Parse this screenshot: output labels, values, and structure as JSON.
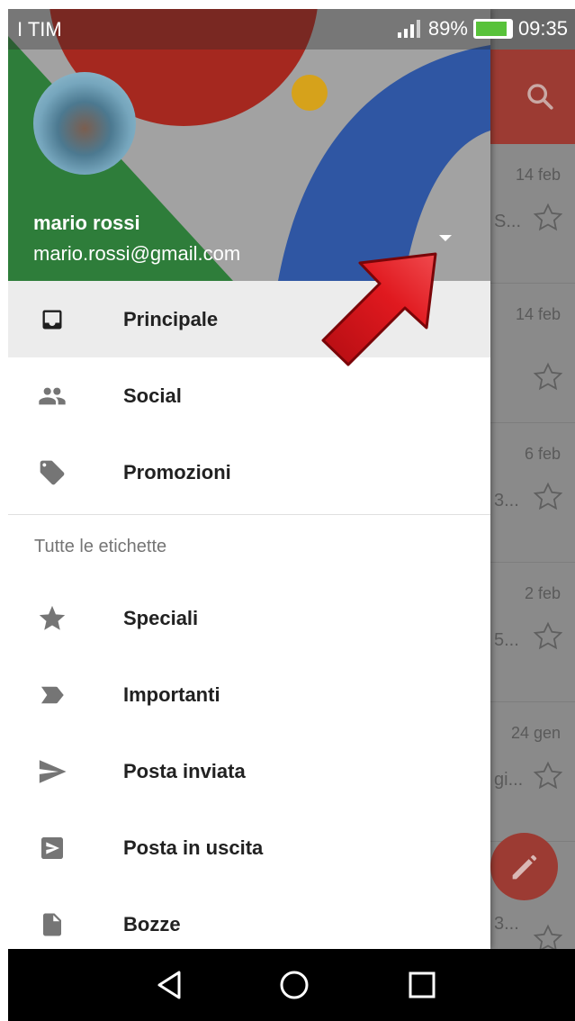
{
  "status_bar": {
    "carrier": "I TIM",
    "battery_percent": "89%",
    "battery_level": 0.89,
    "time": "09:35"
  },
  "drawer": {
    "account": {
      "name": "mario rossi",
      "email": "mario.rossi@gmail.com"
    },
    "primary_items": [
      {
        "label": "Principale",
        "icon": "inbox-icon",
        "active": true
      },
      {
        "label": "Social",
        "icon": "people-icon",
        "active": false
      },
      {
        "label": "Promozioni",
        "icon": "tag-icon",
        "active": false
      }
    ],
    "section_header": "Tutte le etichette",
    "label_items": [
      {
        "label": "Speciali",
        "icon": "star-icon"
      },
      {
        "label": "Importanti",
        "icon": "important-icon"
      },
      {
        "label": "Posta inviata",
        "icon": "send-icon"
      },
      {
        "label": "Posta in uscita",
        "icon": "outbox-icon"
      },
      {
        "label": "Bozze",
        "icon": "draft-icon"
      }
    ]
  },
  "background_list": {
    "rows": [
      {
        "date": "14 feb",
        "snippet": "S..."
      },
      {
        "date": "14 feb",
        "snippet": ""
      },
      {
        "date": "6 feb",
        "snippet": "3..."
      },
      {
        "date": "2 feb",
        "snippet": "5..."
      },
      {
        "date": "24 gen",
        "snippet": "gi..."
      },
      {
        "date": "",
        "snippet": "3..."
      }
    ]
  },
  "colors": {
    "toolbar_red": "#9c3b33",
    "header_blue": "#2f56a3",
    "header_green": "#2e7d3a",
    "header_red": "#a5281f",
    "header_yellow": "#d6a21b",
    "arrow_red": "#d6141b"
  }
}
